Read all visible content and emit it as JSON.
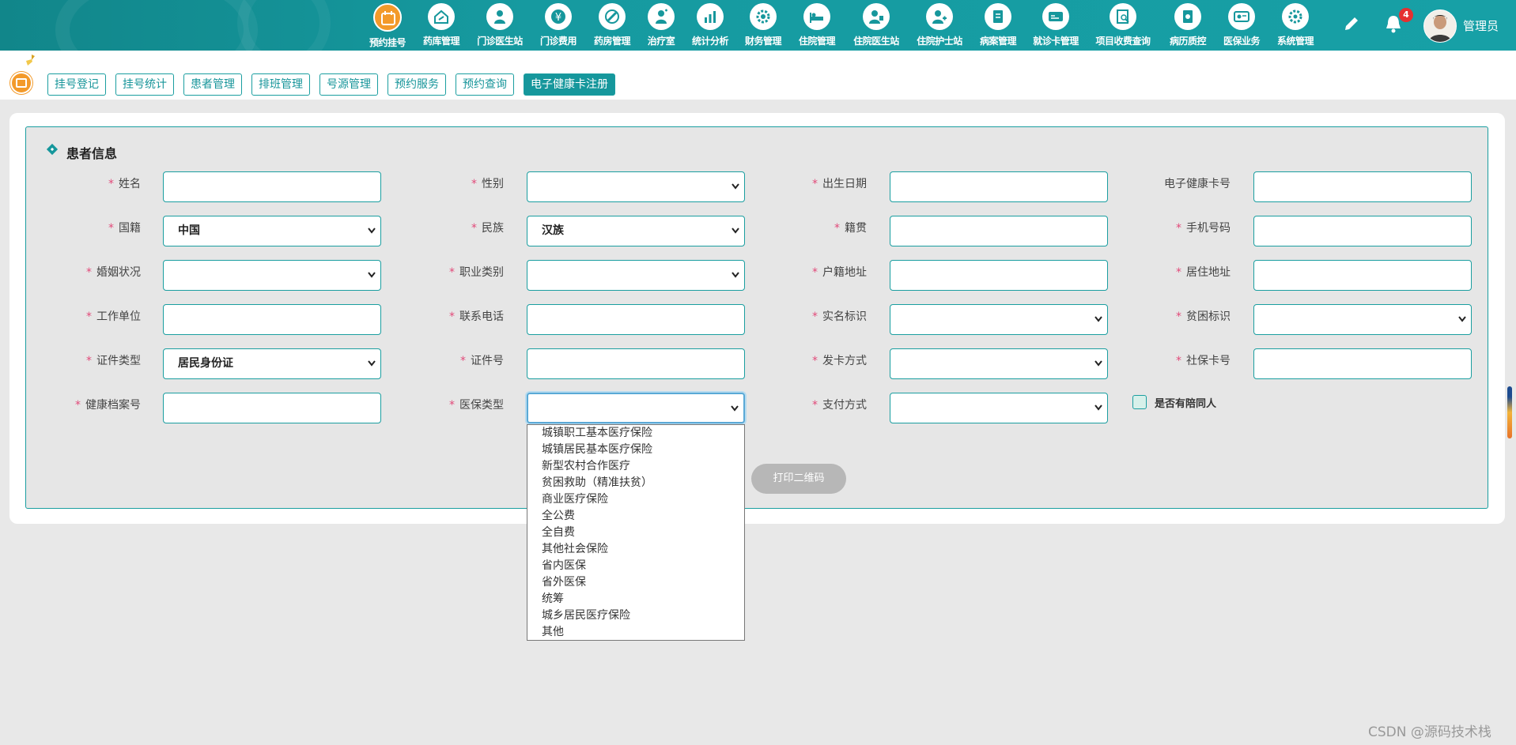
{
  "nav": {
    "items": [
      {
        "label": "预约挂号",
        "icon": "calendar-icon",
        "active": true
      },
      {
        "label": "药库管理",
        "icon": "pharmacy-icon"
      },
      {
        "label": "门诊医生站",
        "icon": "doctor-icon"
      },
      {
        "label": "门诊费用",
        "icon": "yen-icon"
      },
      {
        "label": "药房管理",
        "icon": "pill-icon"
      },
      {
        "label": "治疗室",
        "icon": "nurse-icon"
      },
      {
        "label": "统计分析",
        "icon": "chart-icon"
      },
      {
        "label": "财务管理",
        "icon": "finance-gear-icon"
      },
      {
        "label": "住院管理",
        "icon": "bed-icon"
      },
      {
        "label": "住院医生站",
        "icon": "inpatient-doctor-icon"
      },
      {
        "label": "住院护士站",
        "icon": "inpatient-nurse-icon"
      },
      {
        "label": "病案管理",
        "icon": "record-icon"
      },
      {
        "label": "就诊卡管理",
        "icon": "card-icon"
      },
      {
        "label": "项目收费查询",
        "icon": "search-doc-icon"
      },
      {
        "label": "病历质控",
        "icon": "quality-icon"
      },
      {
        "label": "医保业务",
        "icon": "insurance-icon"
      },
      {
        "label": "系统管理",
        "icon": "settings-icon"
      }
    ],
    "notification_count": "4",
    "username": "管理员"
  },
  "tabs": [
    {
      "label": "挂号登记"
    },
    {
      "label": "挂号统计"
    },
    {
      "label": "患者管理"
    },
    {
      "label": "排班管理"
    },
    {
      "label": "号源管理"
    },
    {
      "label": "预约服务"
    },
    {
      "label": "预约查询"
    },
    {
      "label": "电子健康卡注册",
      "active": true
    }
  ],
  "form": {
    "title": "患者信息",
    "fields": {
      "name": {
        "label": "姓名",
        "required": true,
        "value": ""
      },
      "gender": {
        "label": "性别",
        "required": true,
        "value": ""
      },
      "birth_date": {
        "label": "出生日期",
        "required": true,
        "value": ""
      },
      "health_card_no": {
        "label": "电子健康卡号",
        "required": false,
        "value": ""
      },
      "nationality": {
        "label": "国籍",
        "required": true,
        "value": "中国"
      },
      "ethnicity": {
        "label": "民族",
        "required": true,
        "value": "汉族"
      },
      "native_place": {
        "label": "籍贯",
        "required": true,
        "value": ""
      },
      "mobile": {
        "label": "手机号码",
        "required": true,
        "value": ""
      },
      "marital_status": {
        "label": "婚姻状况",
        "required": true,
        "value": ""
      },
      "occupation": {
        "label": "职业类别",
        "required": true,
        "value": ""
      },
      "household_address": {
        "label": "户籍地址",
        "required": true,
        "value": ""
      },
      "residence_address": {
        "label": "居住地址",
        "required": true,
        "value": ""
      },
      "work_unit": {
        "label": "工作单位",
        "required": true,
        "value": ""
      },
      "contact_phone": {
        "label": "联系电话",
        "required": true,
        "value": ""
      },
      "real_name_flag": {
        "label": "实名标识",
        "required": true,
        "value": ""
      },
      "poverty_flag": {
        "label": "贫困标识",
        "required": true,
        "value": ""
      },
      "id_type": {
        "label": "证件类型",
        "required": true,
        "value": "居民身份证"
      },
      "id_number": {
        "label": "证件号",
        "required": true,
        "value": ""
      },
      "card_issue_method": {
        "label": "发卡方式",
        "required": true,
        "value": ""
      },
      "social_security_no": {
        "label": "社保卡号",
        "required": true,
        "value": ""
      },
      "health_record_no": {
        "label": "健康档案号",
        "required": true,
        "value": ""
      },
      "insurance_type": {
        "label": "医保类型",
        "required": true,
        "value": ""
      },
      "payment_method": {
        "label": "支付方式",
        "required": true,
        "value": ""
      }
    },
    "companion_label": "是否有陪同人",
    "companion_checked": false,
    "print_button": "打印二维码"
  },
  "insurance_options": [
    "城镇职工基本医疗保险",
    "城镇居民基本医疗保险",
    "新型农村合作医疗",
    "贫困救助（精准扶贫）",
    "商业医疗保险",
    "全公费",
    "全自费",
    "其他社会保险",
    "省内医保",
    "省外医保",
    "统筹",
    "城乡居民医疗保险",
    "其他"
  ],
  "watermark": "CSDN @源码技术栈",
  "colors": {
    "primary": "#16979c",
    "accent": "#f39a2a",
    "required": "#e24a7a",
    "badge": "#e53030"
  }
}
